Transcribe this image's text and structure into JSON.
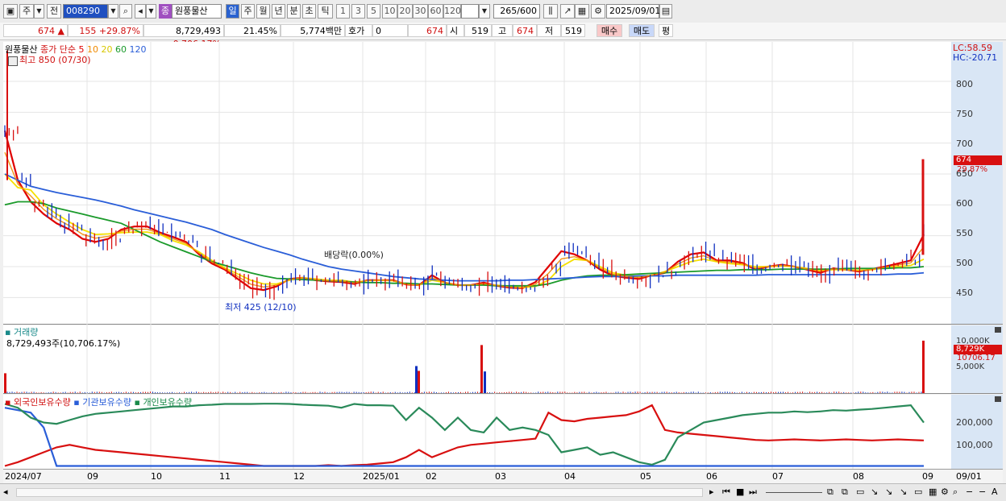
{
  "toolbar": {
    "market": "주",
    "period_prefix": "전",
    "code": "008290",
    "stock_name_badge": "종",
    "stock_name": "원풍물산",
    "periods": [
      "일",
      "주",
      "월",
      "년",
      "분",
      "초",
      "틱"
    ],
    "intervals": [
      "1",
      "3",
      "5",
      "10",
      "20",
      "30",
      "60",
      "120"
    ],
    "count": "265",
    "count_max": "/600",
    "date": "2025/09/01"
  },
  "quote": {
    "price": "674",
    "change": "155",
    "change_pct": "+29.87%",
    "volume": "8,729,493",
    "volume_pct": "0,706.17%",
    "turnover": "21.45%",
    "amount": "5,774백만",
    "hoga_label": "호가",
    "hoga_value": "0",
    "hoga_price": "674",
    "open_label": "시",
    "open": "519",
    "high_label": "고",
    "high": "674",
    "low_label": "저",
    "low": "519",
    "buy": "매수",
    "sell": "매도",
    "avg": "평"
  },
  "price_panel": {
    "name": "원풍물산",
    "ma_label": "종가 단순",
    "ma_periods": [
      "5",
      "10",
      "20",
      "60",
      "120"
    ],
    "high_note": "최고 850 (07/30)",
    "low_note": "최저 425 (12/10)",
    "dividend_note": "배당락(0.00%)",
    "lc": "LC:58.59",
    "hc": "HC:-20.71",
    "y_ticks": [
      "800",
      "750",
      "700",
      "650",
      "600",
      "550",
      "500",
      "450"
    ],
    "last_price_tag": "674",
    "last_pct_tag": "29.87%"
  },
  "volume_panel": {
    "title": "거래량",
    "summary": "8,729,493주(10,706.17%)",
    "y_ticks": [
      "10,000K",
      "5,000K"
    ],
    "last_tag": "8,729K",
    "last_pct_tag": "10706.17"
  },
  "holding_panel": {
    "legend": [
      "외국인보유수량",
      "기관보유수량",
      "개인보유수량"
    ],
    "y_ticks": [
      "200,000",
      "100,000"
    ]
  },
  "x_axis": {
    "labels": [
      "2024/07",
      "09",
      "10",
      "11",
      "12",
      "2025/01",
      "02",
      "03",
      "04",
      "05",
      "06",
      "07",
      "08",
      "09"
    ],
    "right_label": "09/01"
  },
  "colors": {
    "up": "#d81010",
    "down": "#1030c0",
    "ma5": "#e00000",
    "ma10": "#f08a00",
    "ma20": "#f5e000",
    "ma60": "#1a9a2a",
    "ma120": "#2a5ed8"
  },
  "chart_data": {
    "type": "line",
    "price_range": [
      410,
      860
    ],
    "series": [
      {
        "name": "5",
        "values": [
          720,
          640,
          605,
          585,
          570,
          560,
          545,
          540,
          545,
          560,
          565,
          565,
          555,
          548,
          540,
          520,
          505,
          495,
          480,
          465,
          462,
          468,
          480,
          482,
          478,
          476,
          475,
          472,
          478,
          478,
          478,
          471,
          470,
          486,
          474,
          470,
          470,
          474,
          469,
          466,
          465,
          475,
          500,
          525,
          520,
          510,
          495,
          485,
          482,
          480,
          486,
          490,
          508,
          520,
          523,
          510,
          510,
          506,
          495,
          500,
          503,
          500,
          495,
          490,
          497,
          495,
          492,
          496,
          500,
          505,
          510,
          552
        ]
      },
      {
        "name": "20",
        "values": [
          650,
          628,
          624,
          600,
          585,
          572,
          560,
          552,
          553,
          555,
          556,
          556,
          552,
          542,
          535,
          524,
          510,
          498,
          488,
          478,
          472,
          472,
          478,
          482,
          480,
          478,
          478,
          475,
          477,
          478,
          477,
          472,
          470,
          478,
          474,
          470,
          470,
          471,
          470,
          468,
          466,
          468,
          478,
          500,
          512,
          510,
          500,
          490,
          486,
          484,
          486,
          492,
          500,
          508,
          512,
          508,
          505,
          503,
          500,
          500,
          501,
          500,
          497,
          494,
          495,
          495,
          494,
          495,
          498,
          500,
          502,
          512
        ]
      },
      {
        "name": "60",
        "values": [
          600,
          605,
          605,
          602,
          595,
          590,
          585,
          580,
          575,
          570,
          560,
          550,
          540,
          532,
          524,
          516,
          508,
          502,
          496,
          490,
          485,
          481,
          480,
          479,
          478,
          477,
          476,
          475,
          474,
          474,
          473,
          473,
          472,
          472,
          471,
          470,
          470,
          470,
          469,
          469,
          469,
          469,
          472,
          478,
          482,
          485,
          486,
          486,
          487,
          488,
          489,
          490,
          491,
          492,
          493,
          494,
          494,
          495,
          495,
          495,
          496,
          496,
          496,
          496,
          496,
          497,
          497,
          497,
          497,
          498,
          498,
          500
        ]
      },
      {
        "name": "120",
        "values": [
          650,
          640,
          630,
          625,
          620,
          616,
          612,
          608,
          603,
          598,
          592,
          587,
          582,
          577,
          572,
          566,
          560,
          552,
          545,
          538,
          531,
          525,
          519,
          512,
          506,
          500,
          496,
          493,
          490,
          487,
          484,
          482,
          480,
          479,
          478,
          477,
          477,
          477,
          477,
          478,
          478,
          479,
          480,
          481,
          482,
          483,
          484,
          484,
          484,
          485,
          485,
          485,
          486,
          486,
          486,
          486,
          486,
          486,
          486,
          487,
          487,
          487,
          487,
          487,
          487,
          487,
          487,
          487,
          487,
          488,
          488,
          490
        ]
      }
    ],
    "holding": {
      "range": [
        0,
        260000
      ],
      "series": [
        {
          "name": "외국인보유수량",
          "values": [
            5000,
            20000,
            40000,
            60000,
            80000,
            90000,
            80000,
            70000,
            65000,
            60000,
            55000,
            50000,
            45000,
            40000,
            35000,
            30000,
            25000,
            20000,
            15000,
            10000,
            5000,
            5000,
            5000,
            5000,
            5000,
            8000,
            5000,
            8000,
            10000,
            15000,
            20000,
            40000,
            70000,
            40000,
            60000,
            80000,
            90000,
            95000,
            100000,
            105000,
            110000,
            115000,
            220000,
            190000,
            185000,
            195000,
            200000,
            205000,
            210000,
            225000,
            250000,
            150000,
            140000,
            135000,
            130000,
            125000,
            120000,
            115000,
            110000,
            108000,
            110000,
            112000,
            110000,
            108000,
            110000,
            112000,
            110000,
            108000,
            110000,
            112000,
            110000,
            108000
          ]
        },
        {
          "name": "기관보유수량",
          "values": [
            240000,
            230000,
            220000,
            160000,
            5000,
            5000,
            5000,
            5000,
            5000,
            5000,
            5000,
            5000,
            5000,
            5000,
            5000,
            5000,
            5000,
            5000,
            5000,
            5000,
            5000,
            5000,
            5000,
            5000,
            5000,
            5000,
            5000,
            5000,
            5000,
            5000,
            5000,
            5000,
            5000,
            5000,
            5000,
            5000,
            5000,
            5000,
            5000,
            5000,
            5000,
            5000,
            5000,
            5000,
            5000,
            5000,
            5000,
            5000,
            5000,
            5000,
            5000,
            5000,
            5000,
            5000,
            5000,
            5000,
            5000,
            5000,
            5000,
            5000,
            5000,
            5000,
            5000,
            5000,
            5000,
            5000,
            5000,
            5000,
            5000,
            5000,
            5000,
            5000
          ]
        },
        {
          "name": "개인보유수량",
          "values": [
            255000,
            240000,
            200000,
            180000,
            175000,
            190000,
            205000,
            215000,
            220000,
            225000,
            230000,
            235000,
            240000,
            245000,
            245000,
            250000,
            252000,
            255000,
            255000,
            255000,
            256000,
            256000,
            255000,
            252000,
            250000,
            248000,
            240000,
            255000,
            250000,
            250000,
            248000,
            190000,
            240000,
            200000,
            150000,
            200000,
            150000,
            140000,
            200000,
            150000,
            160000,
            150000,
            130000,
            60000,
            70000,
            80000,
            50000,
            60000,
            40000,
            20000,
            10000,
            30000,
            120000,
            150000,
            180000,
            190000,
            200000,
            210000,
            215000,
            220000,
            220000,
            225000,
            222000,
            225000,
            230000,
            228000,
            232000,
            235000,
            240000,
            245000,
            250000,
            180000
          ]
        }
      ]
    },
    "volume_spikes": [
      {
        "x": "2024/07",
        "value": 3300
      },
      {
        "x": "2025/02",
        "value": 4500
      },
      {
        "x": "2025/02",
        "value": 3700
      },
      {
        "x": "2025/03",
        "value": 8000
      },
      {
        "x": "2025/03",
        "value": 3600
      },
      {
        "x": "2025/09",
        "value": 8729
      }
    ]
  }
}
